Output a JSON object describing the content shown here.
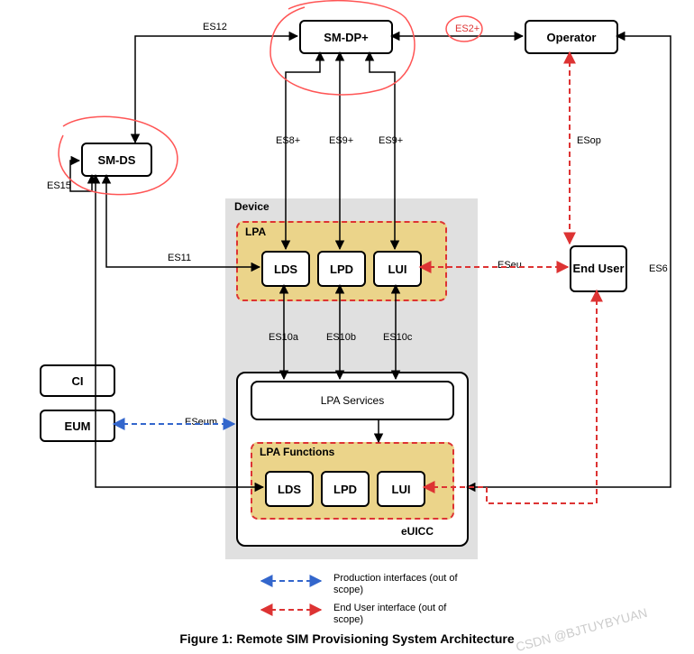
{
  "boxes": {
    "smdp": "SM-DP+",
    "operator": "Operator",
    "smds": "SM-DS",
    "lds1": "LDS",
    "lpd1": "LPD",
    "lui1": "LUI",
    "enduser": "End User",
    "ci": "CI",
    "eum": "EUM",
    "lpasvc": "LPA Services",
    "lds2": "LDS",
    "lpd2": "LPD",
    "lui2": "LUI"
  },
  "groups": {
    "device": "Device",
    "lpa": "LPA",
    "lpaf": "LPA Functions",
    "euicc": "eUICC"
  },
  "labels": {
    "es12": "ES12",
    "es2p": "ES2+",
    "es8": "ES8+",
    "es9a": "ES9+",
    "es9b": "ES9+",
    "esop": "ESop",
    "es15": "ES15",
    "es11": "ES11",
    "eseu": "ESeu",
    "es6": "ES6",
    "es10a": "ES10a",
    "es10b": "ES10b",
    "es10c": "ES10c",
    "eseum": "ESeum"
  },
  "legend": {
    "prod": "Production interfaces (out of scope)",
    "eu": "End User interface (out of scope)"
  },
  "caption": "Figure 1: Remote SIM Provisioning System Architecture",
  "watermark": "CSDN @BJTUYBYUAN"
}
